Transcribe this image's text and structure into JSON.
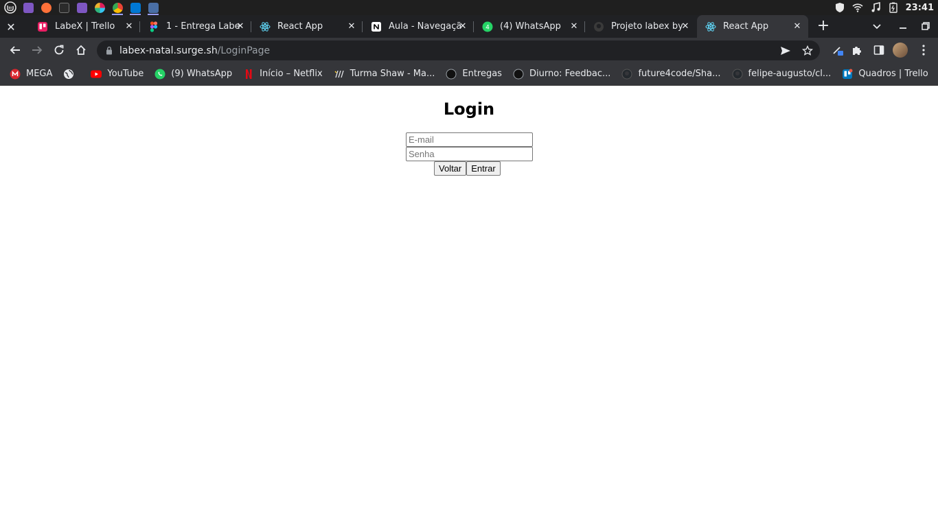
{
  "os_panel": {
    "launchers": [
      {
        "icon": "mint-menu-icon",
        "color": "#e8e8e8"
      },
      {
        "icon": "workspace-icon",
        "color": "#7e57c2"
      },
      {
        "icon": "firefox-icon",
        "color": "#ff7139"
      },
      {
        "icon": "terminal-icon",
        "color": "#2b2b2b"
      },
      {
        "icon": "files-icon",
        "color": "#7e57c2"
      },
      {
        "icon": "slack-icon",
        "color": "#e01e5a"
      },
      {
        "icon": "chrome-icon",
        "color": "#fbbc04"
      },
      {
        "icon": "vscode-icon",
        "color": "#0078d4"
      },
      {
        "icon": "app-icon",
        "color": "#4a90e2"
      }
    ],
    "clock": "23:41"
  },
  "tabs": [
    {
      "title": "LabeX | Trello",
      "favicon": "trello-icon",
      "favicon_color": "#e91e63"
    },
    {
      "title": "1 - Entrega Labe",
      "favicon": "figma-icon",
      "favicon_color": "#f24e1e"
    },
    {
      "title": "React App",
      "favicon": "react-icon",
      "favicon_color": "#61dafb"
    },
    {
      "title": "Aula - Navegaçã",
      "favicon": "notion-icon",
      "favicon_color": "#ffffff"
    },
    {
      "title": "(4) WhatsApp",
      "favicon": "whatsapp-icon",
      "favicon_color": "#25d366"
    },
    {
      "title": "Projeto labex by",
      "favicon": "github-icon",
      "favicon_color": "#3a3a3a"
    },
    {
      "title": "React App",
      "favicon": "react-icon",
      "favicon_color": "#61dafb",
      "active": true
    }
  ],
  "toolbar": {
    "url_host": "labex-natal.surge.sh",
    "url_path": "/LoginPage"
  },
  "bookmarks": [
    {
      "label": "MEGA",
      "icon": "mega-icon",
      "color": "#d9272e"
    },
    {
      "label": "",
      "icon": "globe-icon",
      "color": "#e8eaed"
    },
    {
      "label": "YouTube",
      "icon": "youtube-icon",
      "color": "#ff0000"
    },
    {
      "label": "(9) WhatsApp",
      "icon": "whatsapp-icon",
      "color": "#25d366"
    },
    {
      "label": "Início – Netflix",
      "icon": "netflix-icon",
      "color": "#e50914"
    },
    {
      "label": "Turma Shaw - Ma...",
      "icon": "miro-icon",
      "color": "#050038"
    },
    {
      "label": "Entregas",
      "icon": "circle-icon",
      "color": "#111111"
    },
    {
      "label": "Diurno: Feedbac...",
      "icon": "circle-icon",
      "color": "#111111"
    },
    {
      "label": "future4code/Sha...",
      "icon": "github-icon",
      "color": "#24292e"
    },
    {
      "label": "felipe-augusto/cl...",
      "icon": "github-icon",
      "color": "#24292e"
    },
    {
      "label": "Quadros | Trello",
      "icon": "trello-icon",
      "color": "#0079bf"
    }
  ],
  "page": {
    "title": "Login",
    "email_placeholder": "E-mail",
    "password_placeholder": "Senha",
    "back_label": "Voltar",
    "submit_label": "Entrar"
  }
}
